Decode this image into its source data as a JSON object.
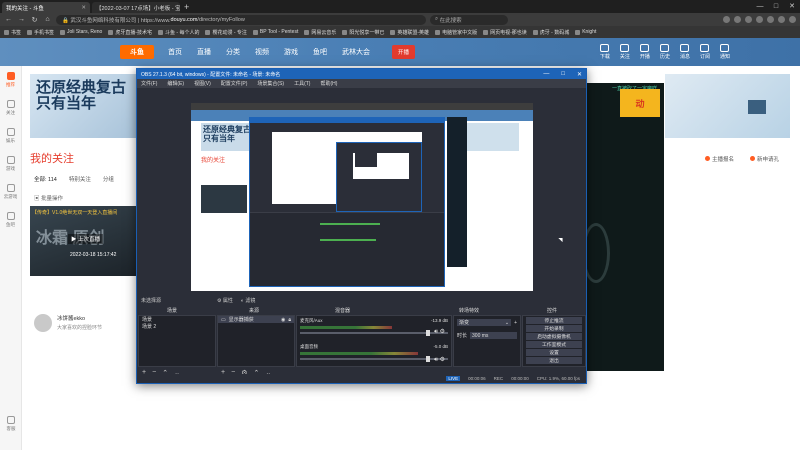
{
  "browser": {
    "tabs": [
      {
        "label": "我的关注 - 斗鱼",
        "active": true
      },
      {
        "label": "【2022-03-07 17点场】小老板 - 宝...",
        "active": false
      }
    ],
    "url_prefix": "🔒 武汉斗鱼网络科技有限公司 | https://www.",
    "url_domain": "douyu.com",
    "url_path": "/directory/myFollow",
    "search_placeholder": "在此搜索",
    "bookmarks": [
      "书签",
      "手机书签",
      "Joli Stars, Reno",
      "虎牙直播-技术宅",
      "斗鱼 - 每个人的",
      "樱花动漫 - 专注",
      "BP Tool - Pentest",
      "网易云音乐",
      "阳光悦享一带已",
      "英雄联盟-英雄",
      "电脑管家中文版",
      "网页电视-那也读",
      "虎牙 - 数码城",
      "Knight"
    ]
  },
  "douyu": {
    "logo": "斗鱼",
    "nav": [
      "首页",
      "直播",
      "分类",
      "视频",
      "游戏",
      "鱼吧",
      "武林大会"
    ],
    "live_button": "开播",
    "nav_icons": [
      "下载",
      "关注",
      "开播",
      "历史",
      "消息",
      "订阅",
      "通知"
    ],
    "sidebar": [
      {
        "label": "推荐",
        "active": true
      },
      {
        "label": "关注",
        "active": false
      },
      {
        "label": "娱乐",
        "active": false
      },
      {
        "label": "游戏",
        "active": false
      },
      {
        "label": "云游戏",
        "active": false
      },
      {
        "label": "鱼吧",
        "active": false
      }
    ],
    "sidebar_bottom": "客服",
    "banner_text": "还原经典复古 只有当年",
    "follow_title": "我的关注",
    "follow_tabs": [
      "全部: 114",
      "特别关注",
      "分组"
    ],
    "batch_label": "批量操作",
    "thumb_title": "【传奇】V1.0绝世无双一天登入直播间",
    "thumb_big": "冰霜 原创",
    "thumb_badge": "▶ 上次直播",
    "thumb_time": "2022-03-18 15:17:42",
    "streamer_name": "冰饼酱ekko",
    "streamer_desc": "大家喜欢的捏脸环节",
    "right_links": [
      "主播报名",
      "新申请孔"
    ],
    "promo_text": "一直被砍了一定魔咩",
    "promo_badge": "动"
  },
  "obs": {
    "title": "OBS 27.1.3 (64 bit, windows) - 配置文件: 未命名 - 场景: 未命名",
    "window_controls": [
      "—",
      "□",
      "✕"
    ],
    "menu": [
      "文件(F)",
      "编辑(E)",
      "视图(V)",
      "配置文件(P)",
      "场景集合(S)",
      "工具(T)",
      "帮助(H)"
    ],
    "source_bar": "未选择源",
    "props_label": "属性",
    "filters_label": "滤镜",
    "dock_titles": [
      "场景",
      "来源",
      "混音器",
      "转场特效",
      "控件"
    ],
    "scenes": [
      "场景",
      "场景 2"
    ],
    "sources": [
      {
        "name": "显示器捕获"
      }
    ],
    "mixer": [
      {
        "name": "麦克风/Aux",
        "db": "-13.9 dB",
        "level": 0.62
      },
      {
        "name": "桌面音频",
        "db": "-5.0 dB",
        "level": 0.8
      }
    ],
    "transition": {
      "type": "渐变",
      "duration_label": "时长",
      "duration": "300 ms"
    },
    "controls": [
      "停止推流",
      "开始录制",
      "启动虚拟摄像机",
      "工作室模式",
      "设置",
      "退出"
    ],
    "status": {
      "live_tag": "LIVE",
      "live_time": "00:00:06",
      "rec_tag": "REC",
      "rec_time": "00:00:00",
      "cpu": "CPU: 1.9%, 60.00 fps"
    }
  }
}
